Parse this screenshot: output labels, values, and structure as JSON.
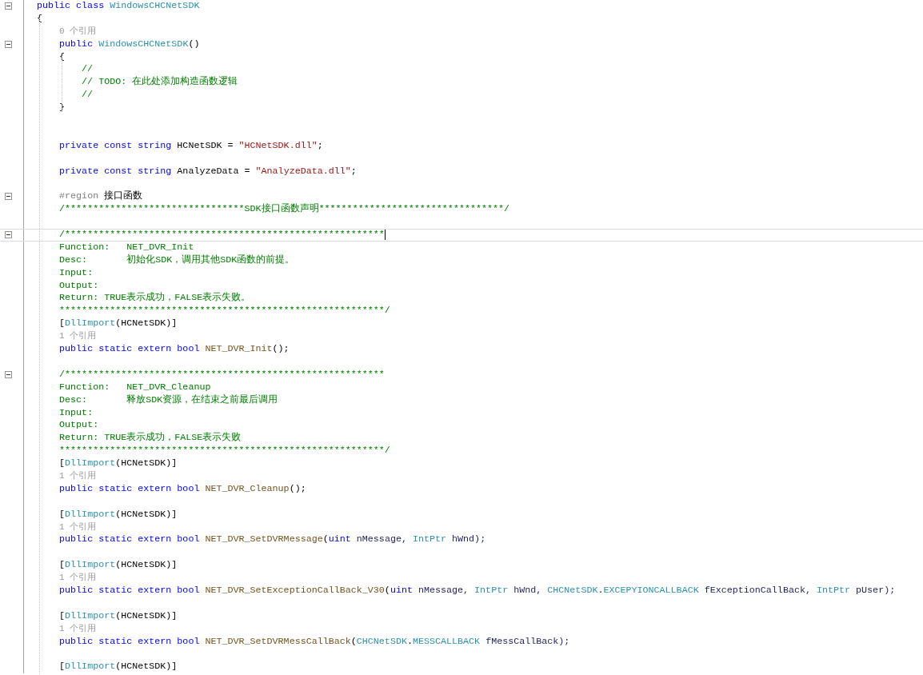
{
  "editor": {
    "lines": [
      {
        "fold": true,
        "current": false,
        "tokens": [
          {
            "text": "public class ",
            "kind": "kw"
          },
          {
            "text": "WindowsCHCNetSDK",
            "kind": "type"
          }
        ]
      },
      {
        "fold": false,
        "current": false,
        "tokens": [
          {
            "text": "{",
            "kind": "plain"
          }
        ]
      },
      {
        "fold": false,
        "current": false,
        "tokens": [
          {
            "text": "    0 个引用",
            "kind": "ref"
          }
        ]
      },
      {
        "fold": true,
        "current": false,
        "tokens": [
          {
            "text": "    public ",
            "kind": "kw"
          },
          {
            "text": "WindowsCHCNetSDK",
            "kind": "type"
          },
          {
            "text": "()",
            "kind": "plain"
          }
        ]
      },
      {
        "fold": false,
        "current": false,
        "tokens": [
          {
            "text": "    {",
            "kind": "plain"
          }
        ]
      },
      {
        "fold": false,
        "current": false,
        "tokens": [
          {
            "text": "        //",
            "kind": "comment"
          }
        ]
      },
      {
        "fold": false,
        "current": false,
        "tokens": [
          {
            "text": "        // TODO: 在此处添加构造函数逻辑",
            "kind": "comment"
          }
        ]
      },
      {
        "fold": false,
        "current": false,
        "tokens": [
          {
            "text": "        //",
            "kind": "comment"
          }
        ]
      },
      {
        "fold": false,
        "current": false,
        "tokens": [
          {
            "text": "    }",
            "kind": "plain"
          }
        ]
      },
      {
        "fold": false,
        "current": false
      },
      {
        "fold": false,
        "current": false
      },
      {
        "fold": false,
        "current": false,
        "tokens": [
          {
            "text": "    private const string ",
            "kind": "kw"
          },
          {
            "text": "HCNetSDK = ",
            "kind": "plain"
          },
          {
            "text": "\"HCNetSDK.dll\"",
            "kind": "str"
          },
          {
            "text": ";",
            "kind": "plain"
          }
        ]
      },
      {
        "fold": false,
        "current": false
      },
      {
        "fold": false,
        "current": false,
        "tokens": [
          {
            "text": "    private const string ",
            "kind": "kw"
          },
          {
            "text": "AnalyzeData = ",
            "kind": "plain"
          },
          {
            "text": "\"AnalyzeData.dll\"",
            "kind": "str"
          },
          {
            "text": ";",
            "kind": "plain"
          }
        ]
      },
      {
        "fold": false,
        "current": false
      },
      {
        "fold": true,
        "current": false,
        "tokens": [
          {
            "text": "    #region ",
            "kind": "pre"
          },
          {
            "text": "接口函数",
            "kind": "plain"
          }
        ]
      },
      {
        "fold": false,
        "current": false,
        "tokens": [
          {
            "text": "    /********************************SDK接口函数声明*********************************/",
            "kind": "comment"
          }
        ]
      },
      {
        "fold": false,
        "current": false
      },
      {
        "fold": true,
        "current": true,
        "tokens": [
          {
            "text": "    /*********************************************************",
            "kind": "comment"
          }
        ]
      },
      {
        "fold": false,
        "current": false,
        "tokens": [
          {
            "text": "    Function:   NET_DVR_Init",
            "kind": "comment"
          }
        ]
      },
      {
        "fold": false,
        "current": false,
        "tokens": [
          {
            "text": "    Desc:       初始化SDK，调用其他SDK函数的前提。",
            "kind": "comment"
          }
        ]
      },
      {
        "fold": false,
        "current": false,
        "tokens": [
          {
            "text": "    Input:",
            "kind": "comment"
          }
        ]
      },
      {
        "fold": false,
        "current": false,
        "tokens": [
          {
            "text": "    Output:",
            "kind": "comment"
          }
        ]
      },
      {
        "fold": false,
        "current": false,
        "tokens": [
          {
            "text": "    Return: TRUE表示成功，FALSE表示失败。",
            "kind": "comment"
          }
        ]
      },
      {
        "fold": false,
        "current": false,
        "tokens": [
          {
            "text": "    **********************************************************/",
            "kind": "comment"
          }
        ]
      },
      {
        "fold": false,
        "current": false,
        "tokens": [
          {
            "text": "    [",
            "kind": "plain"
          },
          {
            "text": "DllImport",
            "kind": "type"
          },
          {
            "text": "(HCNetSDK)]",
            "kind": "plain"
          }
        ]
      },
      {
        "fold": false,
        "current": false,
        "tokens": [
          {
            "text": "    1 个引用",
            "kind": "ref"
          }
        ]
      },
      {
        "fold": false,
        "current": false,
        "tokens": [
          {
            "text": "    public static extern bool ",
            "kind": "kw"
          },
          {
            "text": "NET_DVR_Init",
            "kind": "fn"
          },
          {
            "text": "();",
            "kind": "plain"
          }
        ]
      },
      {
        "fold": false,
        "current": false
      },
      {
        "fold": true,
        "current": false,
        "tokens": [
          {
            "text": "    /*********************************************************",
            "kind": "comment"
          }
        ]
      },
      {
        "fold": false,
        "current": false,
        "tokens": [
          {
            "text": "    Function:   NET_DVR_Cleanup",
            "kind": "comment"
          }
        ]
      },
      {
        "fold": false,
        "current": false,
        "tokens": [
          {
            "text": "    Desc:       释放SDK资源，在结束之前最后调用",
            "kind": "comment"
          }
        ]
      },
      {
        "fold": false,
        "current": false,
        "tokens": [
          {
            "text": "    Input:",
            "kind": "comment"
          }
        ]
      },
      {
        "fold": false,
        "current": false,
        "tokens": [
          {
            "text": "    Output:",
            "kind": "comment"
          }
        ]
      },
      {
        "fold": false,
        "current": false,
        "tokens": [
          {
            "text": "    Return: TRUE表示成功，FALSE表示失败",
            "kind": "comment"
          }
        ]
      },
      {
        "fold": false,
        "current": false,
        "tokens": [
          {
            "text": "    **********************************************************/",
            "kind": "comment"
          }
        ]
      },
      {
        "fold": false,
        "current": false,
        "tokens": [
          {
            "text": "    [",
            "kind": "plain"
          },
          {
            "text": "DllImport",
            "kind": "type"
          },
          {
            "text": "(HCNetSDK)]",
            "kind": "plain"
          }
        ]
      },
      {
        "fold": false,
        "current": false,
        "tokens": [
          {
            "text": "    1 个引用",
            "kind": "ref"
          }
        ]
      },
      {
        "fold": false,
        "current": false,
        "tokens": [
          {
            "text": "    public static extern bool ",
            "kind": "kw"
          },
          {
            "text": "NET_DVR_Cleanup",
            "kind": "fn"
          },
          {
            "text": "();",
            "kind": "plain"
          }
        ]
      },
      {
        "fold": false,
        "current": false
      },
      {
        "fold": false,
        "current": false,
        "tokens": [
          {
            "text": "    [",
            "kind": "plain"
          },
          {
            "text": "DllImport",
            "kind": "type"
          },
          {
            "text": "(HCNetSDK)]",
            "kind": "plain"
          }
        ]
      },
      {
        "fold": false,
        "current": false,
        "tokens": [
          {
            "text": "    1 个引用",
            "kind": "ref"
          }
        ]
      },
      {
        "fold": false,
        "current": false,
        "tokens": [
          {
            "text": "    public static extern bool ",
            "kind": "kw"
          },
          {
            "text": "NET_DVR_SetDVRMessage",
            "kind": "fn"
          },
          {
            "text": "(",
            "kind": "plain"
          },
          {
            "text": "uint ",
            "kind": "kw"
          },
          {
            "text": "nMessage, ",
            "kind": "param"
          },
          {
            "text": "IntPtr",
            "kind": "type"
          },
          {
            "text": " hWnd);",
            "kind": "param"
          }
        ]
      },
      {
        "fold": false,
        "current": false
      },
      {
        "fold": false,
        "current": false,
        "tokens": [
          {
            "text": "    [",
            "kind": "plain"
          },
          {
            "text": "DllImport",
            "kind": "type"
          },
          {
            "text": "(HCNetSDK)]",
            "kind": "plain"
          }
        ]
      },
      {
        "fold": false,
        "current": false,
        "tokens": [
          {
            "text": "    1 个引用",
            "kind": "ref"
          }
        ]
      },
      {
        "fold": false,
        "current": false,
        "tokens": [
          {
            "text": "    public static extern bool ",
            "kind": "kw"
          },
          {
            "text": "NET_DVR_SetExceptionCallBack_V30",
            "kind": "fn"
          },
          {
            "text": "(",
            "kind": "plain"
          },
          {
            "text": "uint ",
            "kind": "kw"
          },
          {
            "text": "nMessage, ",
            "kind": "param"
          },
          {
            "text": "IntPtr",
            "kind": "type"
          },
          {
            "text": " hWnd, ",
            "kind": "param"
          },
          {
            "text": "CHCNetSDK",
            "kind": "type"
          },
          {
            "text": ".",
            "kind": "plain"
          },
          {
            "text": "EXCEPYIONCALLBACK",
            "kind": "type"
          },
          {
            "text": " fExceptionCallBack, ",
            "kind": "param"
          },
          {
            "text": "IntPtr",
            "kind": "type"
          },
          {
            "text": " pUser);",
            "kind": "param"
          }
        ]
      },
      {
        "fold": false,
        "current": false
      },
      {
        "fold": false,
        "current": false,
        "tokens": [
          {
            "text": "    [",
            "kind": "plain"
          },
          {
            "text": "DllImport",
            "kind": "type"
          },
          {
            "text": "(HCNetSDK)]",
            "kind": "plain"
          }
        ]
      },
      {
        "fold": false,
        "current": false,
        "tokens": [
          {
            "text": "    1 个引用",
            "kind": "ref"
          }
        ]
      },
      {
        "fold": false,
        "current": false,
        "tokens": [
          {
            "text": "    public static extern bool ",
            "kind": "kw"
          },
          {
            "text": "NET_DVR_SetDVRMessCallBack",
            "kind": "fn"
          },
          {
            "text": "(",
            "kind": "plain"
          },
          {
            "text": "CHCNetSDK",
            "kind": "type"
          },
          {
            "text": ".",
            "kind": "plain"
          },
          {
            "text": "MESSCALLBACK",
            "kind": "type"
          },
          {
            "text": " fMessCallBack);",
            "kind": "param"
          }
        ]
      },
      {
        "fold": false,
        "current": false
      },
      {
        "fold": false,
        "current": false,
        "tokens": [
          {
            "text": "    [",
            "kind": "plain"
          },
          {
            "text": "DllImport",
            "kind": "type"
          },
          {
            "text": "(HCNetSDK)]",
            "kind": "plain"
          }
        ]
      }
    ]
  }
}
